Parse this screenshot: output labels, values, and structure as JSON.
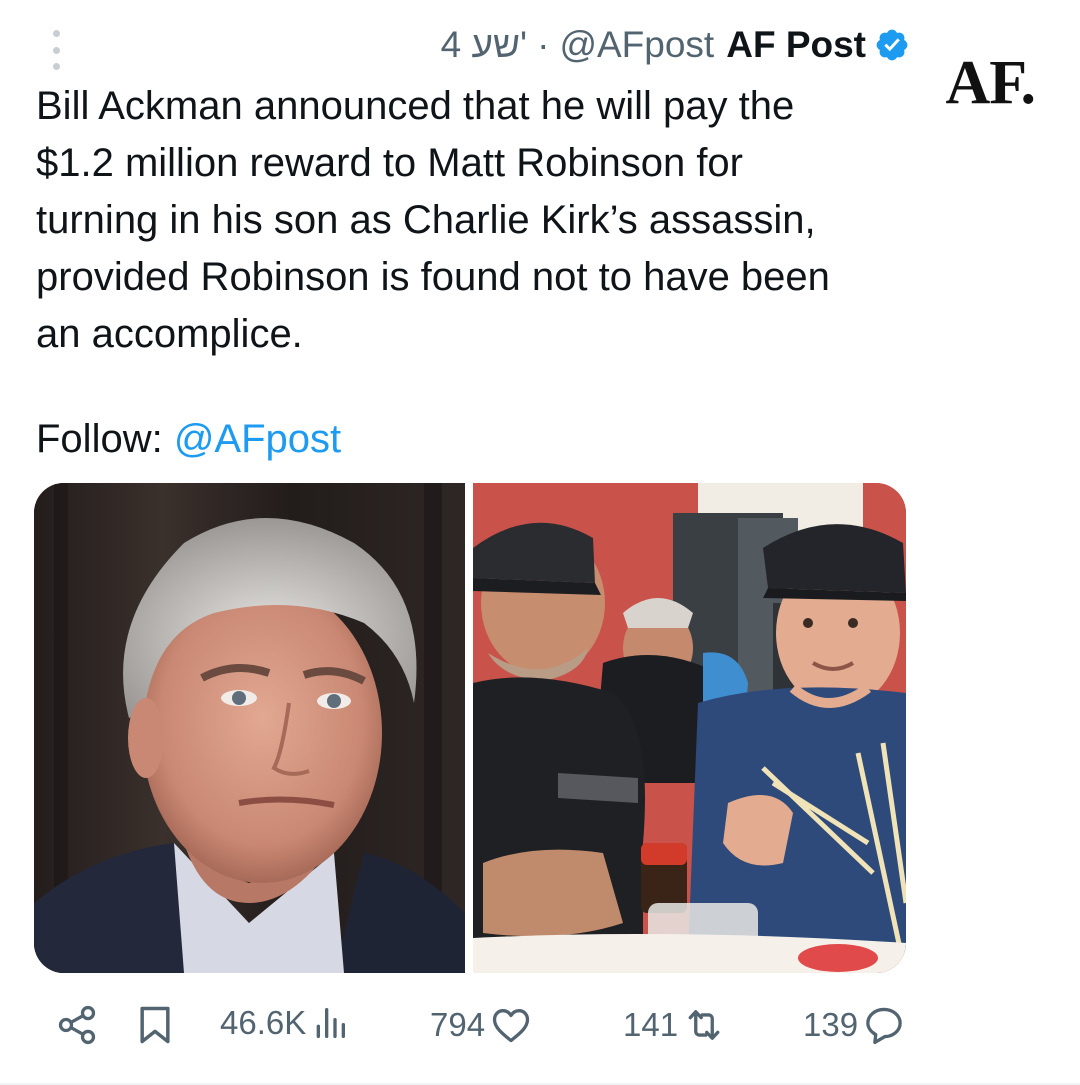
{
  "colors": {
    "accent": "#1d9bf0",
    "text_primary": "#0f1419",
    "text_secondary": "#536471"
  },
  "tweet": {
    "time": "4 שע'",
    "separator": "·",
    "handle": "@AFpost",
    "display_name": "AF Post",
    "verified_icon": "verified-badge-icon",
    "avatar_text": "AF.",
    "body": "Bill Ackman announced that he will pay the\n$1.2 million reward to Matt Robinson for\nturning in his son as Charlie Kirk’s assassin,\nprovided Robinson is found not to have been\nan accomplice.",
    "follow_label": "Follow: ",
    "follow_mention": "@AFpost"
  },
  "media": [
    {
      "icon": "photo-portrait-man-grey-hair"
    },
    {
      "icon": "photo-father-and-son-restaurant"
    }
  ],
  "actions": {
    "share_icon": "share-icon",
    "bookmark_icon": "bookmark-icon",
    "views": "46.6K",
    "views_icon": "views-chart-icon",
    "likes": "794",
    "likes_icon": "heart-icon",
    "reposts": "141",
    "reposts_icon": "repost-icon",
    "replies": "139",
    "replies_icon": "reply-icon"
  }
}
